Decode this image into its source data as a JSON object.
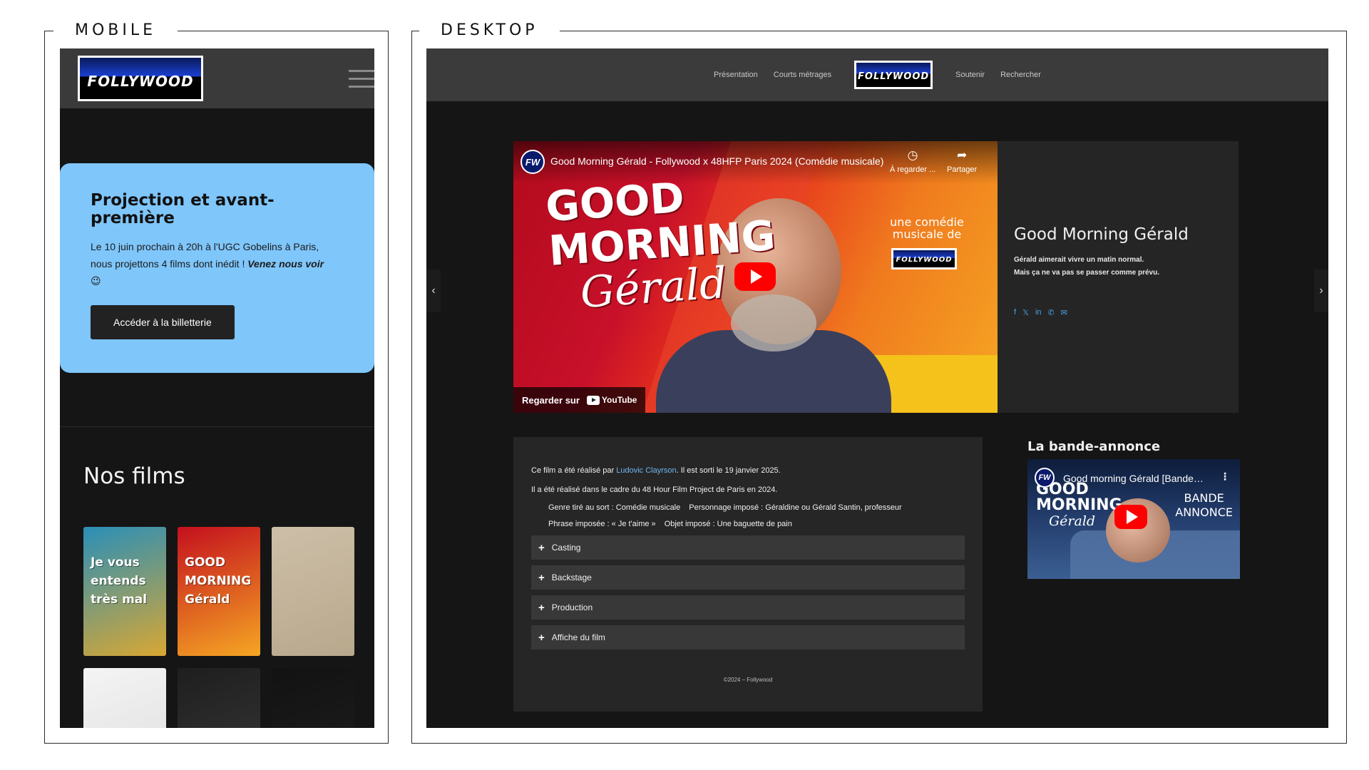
{
  "frames": {
    "mobile_label": "MOBILE",
    "desktop_label": "DESKTOP"
  },
  "brand": {
    "logo_text": "FOLLYWOOD"
  },
  "mobile": {
    "card": {
      "title": "Projection et avant-première",
      "text": "Le 10 juin prochain à 20h à l'UGC Gobelins à Paris, nous projettons 4 films dont inédit ! ",
      "text_em": "Venez nous voir",
      "emoji": "😉",
      "button": "Accéder à la billetterie"
    },
    "films_title": "Nos films",
    "posters": [
      {
        "line1": "Je vous",
        "line2": "entends",
        "line3": "très mal",
        "colors": [
          "#2a8fb8",
          "#d8a733"
        ]
      },
      {
        "line1": "GOOD",
        "line2": "MORNING",
        "line3": "Gérald",
        "colors": [
          "#c4101e",
          "#f5a623"
        ]
      },
      {
        "line1": "",
        "line2": "",
        "line3": "",
        "colors": [
          "#cdbfa8",
          "#b8a88c"
        ]
      },
      {
        "line1": "",
        "line2": "",
        "line3": "",
        "colors": [
          "#f4f4f4",
          "#dcdcdc"
        ]
      },
      {
        "line1": "",
        "line2": "",
        "line3": "",
        "colors": [
          "#1e1e1e",
          "#3a3a3a"
        ]
      },
      {
        "line1": "",
        "line2": "",
        "line3": "",
        "colors": [
          "#121212",
          "#1f1f1f"
        ]
      }
    ]
  },
  "desktop": {
    "nav": {
      "left": [
        "Présentation",
        "Courts métrages"
      ],
      "right": [
        "Soutenir",
        "Rechercher"
      ]
    },
    "video": {
      "badge": "FW",
      "caption": "Good Morning Gérald - Follywood x 48HFP Paris 2024 (Comédie musicale)",
      "watch_later": "À regarder ...",
      "share": "Partager",
      "title_line1": "GOOD",
      "title_line2": "MORNING",
      "title_line3": "Gérald",
      "tagline": "une comédie musicale de",
      "watch_on": "Regarder sur",
      "youtube": "YouTube"
    },
    "hero": {
      "title": "Good Morning Gérald",
      "line1": "Gérald aimerait vivre un matin normal.",
      "line2": "Mais ça ne va pas se passer comme prévu.",
      "share_icons": [
        "f",
        "𝕏",
        "in",
        "✆",
        "✉"
      ]
    },
    "info": {
      "credit_prefix": "Ce film a été réalisé par ",
      "director": "Ludovic Clayrson",
      "credit_suffix": ". Il est sorti le 19 janvier 2025.",
      "context": "Il a été réalisé dans le cadre du 48 Hour Film Project de Paris en 2024.",
      "genre": "Genre tiré au sort : Comédie musicale",
      "character": "Personnage imposé : Géraldine ou Gérald Santin, professeur",
      "phrase": "Phrase imposée : « Je t'aime »",
      "object": "Objet imposé : Une baguette de pain",
      "accordion": [
        "Casting",
        "Backstage",
        "Production",
        "Affiche du film"
      ],
      "copyright": "©2024 – Follywood"
    },
    "trailer": {
      "title": "La bande-annonce",
      "badge": "FW",
      "caption": "Good morning Gérald [Bande-annonce]",
      "title_line1": "GOOD",
      "title_line2": "MORNING",
      "title_line3": "Gérald",
      "ba_line1": "BANDE",
      "ba_line2": "ANNONCE"
    }
  }
}
